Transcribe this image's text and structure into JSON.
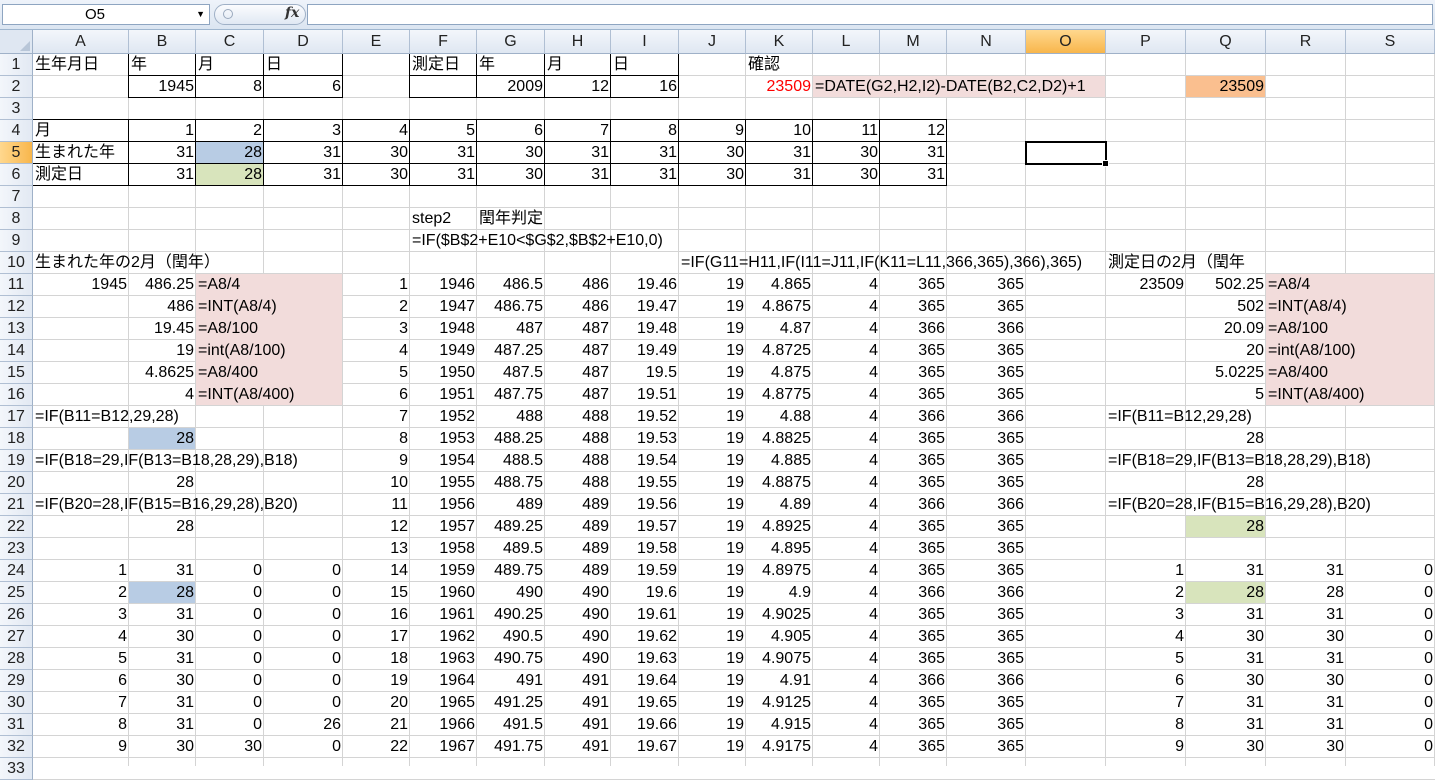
{
  "namebox": {
    "value": "O5",
    "dropdown_icon": "chevron-down-icon"
  },
  "formula_bar": {
    "fx_label": "fx",
    "value": ""
  },
  "columns": [
    "A",
    "B",
    "C",
    "D",
    "E",
    "F",
    "G",
    "H",
    "I",
    "J",
    "K",
    "L",
    "M",
    "N",
    "O",
    "P",
    "Q",
    "R",
    "S"
  ],
  "selected_column": "O",
  "selected_row": 5,
  "rows": [
    "1",
    "2",
    "3",
    "4",
    "5",
    "6",
    "7",
    "8",
    "9",
    "10",
    "11",
    "12",
    "13",
    "14",
    "15",
    "16",
    "17",
    "18",
    "19",
    "20",
    "21",
    "22",
    "23",
    "24",
    "25",
    "26",
    "27",
    "28",
    "29",
    "30",
    "31",
    "32",
    "33"
  ],
  "colors": {
    "pink": "#f2dcdb",
    "blue": "#b8cce4",
    "green": "#d8e4bc",
    "orange": "#fabf8f",
    "red_text": "#ff0000"
  },
  "cells": [
    {
      "c": "A",
      "r": 1,
      "v": "生年月日",
      "t": "txt"
    },
    {
      "c": "B",
      "r": 1,
      "v": "年",
      "t": "txt"
    },
    {
      "c": "C",
      "r": 1,
      "v": "月",
      "t": "txt"
    },
    {
      "c": "D",
      "r": 1,
      "v": "日",
      "t": "txt"
    },
    {
      "c": "F",
      "r": 1,
      "v": "測定日",
      "t": "txt"
    },
    {
      "c": "G",
      "r": 1,
      "v": "年",
      "t": "txt"
    },
    {
      "c": "H",
      "r": 1,
      "v": "月",
      "t": "txt"
    },
    {
      "c": "I",
      "r": 1,
      "v": "日",
      "t": "txt"
    },
    {
      "c": "K",
      "r": 1,
      "v": "確認",
      "t": "txt"
    },
    {
      "c": "B",
      "r": 2,
      "v": "1945",
      "t": "num"
    },
    {
      "c": "C",
      "r": 2,
      "v": "8",
      "t": "num"
    },
    {
      "c": "D",
      "r": 2,
      "v": "6",
      "t": "num"
    },
    {
      "c": "G",
      "r": 2,
      "v": "2009",
      "t": "num"
    },
    {
      "c": "H",
      "r": 2,
      "v": "12",
      "t": "num"
    },
    {
      "c": "I",
      "r": 2,
      "v": "16",
      "t": "num"
    },
    {
      "c": "K",
      "r": 2,
      "v": "23509",
      "t": "num",
      "red": true
    },
    {
      "c": "L",
      "r": 2,
      "v": "=DATE(G2,H2,I2)-DATE(B2,C2,D2)+1",
      "t": "txt"
    },
    {
      "c": "Q",
      "r": 2,
      "v": "23509",
      "t": "num"
    },
    {
      "c": "A",
      "r": 4,
      "v": "月",
      "t": "txt"
    },
    {
      "c": "B",
      "r": 4,
      "v": "1",
      "t": "num"
    },
    {
      "c": "C",
      "r": 4,
      "v": "2",
      "t": "num"
    },
    {
      "c": "D",
      "r": 4,
      "v": "3",
      "t": "num"
    },
    {
      "c": "E",
      "r": 4,
      "v": "4",
      "t": "num"
    },
    {
      "c": "F",
      "r": 4,
      "v": "5",
      "t": "num"
    },
    {
      "c": "G",
      "r": 4,
      "v": "6",
      "t": "num"
    },
    {
      "c": "H",
      "r": 4,
      "v": "7",
      "t": "num"
    },
    {
      "c": "I",
      "r": 4,
      "v": "8",
      "t": "num"
    },
    {
      "c": "J",
      "r": 4,
      "v": "9",
      "t": "num"
    },
    {
      "c": "K",
      "r": 4,
      "v": "10",
      "t": "num"
    },
    {
      "c": "L",
      "r": 4,
      "v": "11",
      "t": "num"
    },
    {
      "c": "M",
      "r": 4,
      "v": "12",
      "t": "num"
    },
    {
      "c": "A",
      "r": 5,
      "v": "生まれた年",
      "t": "txt"
    },
    {
      "c": "B",
      "r": 5,
      "v": "31",
      "t": "num"
    },
    {
      "c": "C",
      "r": 5,
      "v": "28",
      "t": "num"
    },
    {
      "c": "D",
      "r": 5,
      "v": "31",
      "t": "num"
    },
    {
      "c": "E",
      "r": 5,
      "v": "30",
      "t": "num"
    },
    {
      "c": "F",
      "r": 5,
      "v": "31",
      "t": "num"
    },
    {
      "c": "G",
      "r": 5,
      "v": "30",
      "t": "num"
    },
    {
      "c": "H",
      "r": 5,
      "v": "31",
      "t": "num"
    },
    {
      "c": "I",
      "r": 5,
      "v": "31",
      "t": "num"
    },
    {
      "c": "J",
      "r": 5,
      "v": "30",
      "t": "num"
    },
    {
      "c": "K",
      "r": 5,
      "v": "31",
      "t": "num"
    },
    {
      "c": "L",
      "r": 5,
      "v": "30",
      "t": "num"
    },
    {
      "c": "M",
      "r": 5,
      "v": "31",
      "t": "num"
    },
    {
      "c": "A",
      "r": 6,
      "v": "測定日",
      "t": "txt"
    },
    {
      "c": "B",
      "r": 6,
      "v": "31",
      "t": "num"
    },
    {
      "c": "C",
      "r": 6,
      "v": "28",
      "t": "num"
    },
    {
      "c": "D",
      "r": 6,
      "v": "31",
      "t": "num"
    },
    {
      "c": "E",
      "r": 6,
      "v": "30",
      "t": "num"
    },
    {
      "c": "F",
      "r": 6,
      "v": "31",
      "t": "num"
    },
    {
      "c": "G",
      "r": 6,
      "v": "30",
      "t": "num"
    },
    {
      "c": "H",
      "r": 6,
      "v": "31",
      "t": "num"
    },
    {
      "c": "I",
      "r": 6,
      "v": "31",
      "t": "num"
    },
    {
      "c": "J",
      "r": 6,
      "v": "30",
      "t": "num"
    },
    {
      "c": "K",
      "r": 6,
      "v": "31",
      "t": "num"
    },
    {
      "c": "L",
      "r": 6,
      "v": "30",
      "t": "num"
    },
    {
      "c": "M",
      "r": 6,
      "v": "31",
      "t": "num"
    },
    {
      "c": "F",
      "r": 8,
      "v": "step2",
      "t": "txt"
    },
    {
      "c": "G",
      "r": 8,
      "v": "閏年判定",
      "t": "txt"
    },
    {
      "c": "F",
      "r": 9,
      "v": "=IF($B$2+E10<$G$2,$B$2+E10,0)",
      "t": "txt"
    },
    {
      "c": "A",
      "r": 10,
      "v": "生まれた年の2月（閏年）",
      "t": "txt"
    },
    {
      "c": "J",
      "r": 10,
      "v": "=IF(G11=H11,IF(I11=J11,IF(K11=L11,366,365),366),365)",
      "t": "txt"
    },
    {
      "c": "P",
      "r": 10,
      "v": "測定日の2月（閏年",
      "t": "txt"
    },
    {
      "c": "A",
      "r": 11,
      "v": "1945",
      "t": "num"
    },
    {
      "c": "B",
      "r": 11,
      "v": "486.25",
      "t": "num"
    },
    {
      "c": "C",
      "r": 11,
      "v": "=A8/4",
      "t": "txt"
    },
    {
      "c": "B",
      "r": 12,
      "v": "486",
      "t": "num"
    },
    {
      "c": "C",
      "r": 12,
      "v": "=INT(A8/4)",
      "t": "txt"
    },
    {
      "c": "B",
      "r": 13,
      "v": "19.45",
      "t": "num"
    },
    {
      "c": "C",
      "r": 13,
      "v": "=A8/100",
      "t": "txt"
    },
    {
      "c": "B",
      "r": 14,
      "v": "19",
      "t": "num"
    },
    {
      "c": "C",
      "r": 14,
      "v": "=int(A8/100)",
      "t": "txt"
    },
    {
      "c": "B",
      "r": 15,
      "v": "4.8625",
      "t": "num"
    },
    {
      "c": "C",
      "r": 15,
      "v": "=A8/400",
      "t": "txt"
    },
    {
      "c": "B",
      "r": 16,
      "v": "4",
      "t": "num"
    },
    {
      "c": "C",
      "r": 16,
      "v": "=INT(A8/400)",
      "t": "txt"
    },
    {
      "c": "A",
      "r": 17,
      "v": "=IF(B11=B12,29,28)",
      "t": "txt"
    },
    {
      "c": "B",
      "r": 18,
      "v": "28",
      "t": "num"
    },
    {
      "c": "A",
      "r": 19,
      "v": "=IF(B18=29,IF(B13=B18,28,29),B18)",
      "t": "txt"
    },
    {
      "c": "B",
      "r": 20,
      "v": "28",
      "t": "num"
    },
    {
      "c": "A",
      "r": 21,
      "v": "=IF(B20=28,IF(B15=B16,29,28),B20)",
      "t": "txt"
    },
    {
      "c": "B",
      "r": 22,
      "v": "28",
      "t": "num"
    },
    {
      "c": "Q",
      "r": 11,
      "v": "502.25",
      "t": "num"
    },
    {
      "c": "P",
      "r": 11,
      "v": "23509",
      "t": "num"
    },
    {
      "c": "R",
      "r": 11,
      "v": "=A8/4",
      "t": "txt"
    },
    {
      "c": "Q",
      "r": 12,
      "v": "502",
      "t": "num"
    },
    {
      "c": "R",
      "r": 12,
      "v": "=INT(A8/4)",
      "t": "txt"
    },
    {
      "c": "Q",
      "r": 13,
      "v": "20.09",
      "t": "num"
    },
    {
      "c": "R",
      "r": 13,
      "v": "=A8/100",
      "t": "txt"
    },
    {
      "c": "Q",
      "r": 14,
      "v": "20",
      "t": "num"
    },
    {
      "c": "R",
      "r": 14,
      "v": "=int(A8/100)",
      "t": "txt"
    },
    {
      "c": "Q",
      "r": 15,
      "v": "5.0225",
      "t": "num"
    },
    {
      "c": "R",
      "r": 15,
      "v": "=A8/400",
      "t": "txt"
    },
    {
      "c": "Q",
      "r": 16,
      "v": "5",
      "t": "num"
    },
    {
      "c": "R",
      "r": 16,
      "v": "=INT(A8/400)",
      "t": "txt"
    },
    {
      "c": "P",
      "r": 17,
      "v": "=IF(B11=B12,29,28)",
      "t": "txt"
    },
    {
      "c": "Q",
      "r": 18,
      "v": "28",
      "t": "num"
    },
    {
      "c": "P",
      "r": 19,
      "v": "=IF(B18=29,IF(B13=B18,28,29),B18)",
      "t": "txt"
    },
    {
      "c": "Q",
      "r": 20,
      "v": "28",
      "t": "num"
    },
    {
      "c": "P",
      "r": 21,
      "v": "=IF(B20=28,IF(B15=B16,29,28),B20)",
      "t": "txt"
    },
    {
      "c": "Q",
      "r": 22,
      "v": "28",
      "t": "num"
    }
  ],
  "leap_table": [
    {
      "r": 11,
      "E": "1",
      "F": "1946",
      "G": "486.5",
      "H": "486",
      "I": "19.46",
      "J": "19",
      "K": "4.865",
      "L": "4",
      "M": "365",
      "N": "365"
    },
    {
      "r": 12,
      "E": "2",
      "F": "1947",
      "G": "486.75",
      "H": "486",
      "I": "19.47",
      "J": "19",
      "K": "4.8675",
      "L": "4",
      "M": "365",
      "N": "365"
    },
    {
      "r": 13,
      "E": "3",
      "F": "1948",
      "G": "487",
      "H": "487",
      "I": "19.48",
      "J": "19",
      "K": "4.87",
      "L": "4",
      "M": "366",
      "N": "366"
    },
    {
      "r": 14,
      "E": "4",
      "F": "1949",
      "G": "487.25",
      "H": "487",
      "I": "19.49",
      "J": "19",
      "K": "4.8725",
      "L": "4",
      "M": "365",
      "N": "365"
    },
    {
      "r": 15,
      "E": "5",
      "F": "1950",
      "G": "487.5",
      "H": "487",
      "I": "19.5",
      "J": "19",
      "K": "4.875",
      "L": "4",
      "M": "365",
      "N": "365"
    },
    {
      "r": 16,
      "E": "6",
      "F": "1951",
      "G": "487.75",
      "H": "487",
      "I": "19.51",
      "J": "19",
      "K": "4.8775",
      "L": "4",
      "M": "365",
      "N": "365"
    },
    {
      "r": 17,
      "E": "7",
      "F": "1952",
      "G": "488",
      "H": "488",
      "I": "19.52",
      "J": "19",
      "K": "4.88",
      "L": "4",
      "M": "366",
      "N": "366"
    },
    {
      "r": 18,
      "E": "8",
      "F": "1953",
      "G": "488.25",
      "H": "488",
      "I": "19.53",
      "J": "19",
      "K": "4.8825",
      "L": "4",
      "M": "365",
      "N": "365"
    },
    {
      "r": 19,
      "E": "9",
      "F": "1954",
      "G": "488.5",
      "H": "488",
      "I": "19.54",
      "J": "19",
      "K": "4.885",
      "L": "4",
      "M": "365",
      "N": "365"
    },
    {
      "r": 20,
      "E": "10",
      "F": "1955",
      "G": "488.75",
      "H": "488",
      "I": "19.55",
      "J": "19",
      "K": "4.8875",
      "L": "4",
      "M": "365",
      "N": "365"
    },
    {
      "r": 21,
      "E": "11",
      "F": "1956",
      "G": "489",
      "H": "489",
      "I": "19.56",
      "J": "19",
      "K": "4.89",
      "L": "4",
      "M": "366",
      "N": "366"
    },
    {
      "r": 22,
      "E": "12",
      "F": "1957",
      "G": "489.25",
      "H": "489",
      "I": "19.57",
      "J": "19",
      "K": "4.8925",
      "L": "4",
      "M": "365",
      "N": "365"
    },
    {
      "r": 23,
      "E": "13",
      "F": "1958",
      "G": "489.5",
      "H": "489",
      "I": "19.58",
      "J": "19",
      "K": "4.895",
      "L": "4",
      "M": "365",
      "N": "365"
    },
    {
      "r": 24,
      "E": "14",
      "F": "1959",
      "G": "489.75",
      "H": "489",
      "I": "19.59",
      "J": "19",
      "K": "4.8975",
      "L": "4",
      "M": "365",
      "N": "365"
    },
    {
      "r": 25,
      "E": "15",
      "F": "1960",
      "G": "490",
      "H": "490",
      "I": "19.6",
      "J": "19",
      "K": "4.9",
      "L": "4",
      "M": "366",
      "N": "366"
    },
    {
      "r": 26,
      "E": "16",
      "F": "1961",
      "G": "490.25",
      "H": "490",
      "I": "19.61",
      "J": "19",
      "K": "4.9025",
      "L": "4",
      "M": "365",
      "N": "365"
    },
    {
      "r": 27,
      "E": "17",
      "F": "1962",
      "G": "490.5",
      "H": "490",
      "I": "19.62",
      "J": "19",
      "K": "4.905",
      "L": "4",
      "M": "365",
      "N": "365"
    },
    {
      "r": 28,
      "E": "18",
      "F": "1963",
      "G": "490.75",
      "H": "490",
      "I": "19.63",
      "J": "19",
      "K": "4.9075",
      "L": "4",
      "M": "365",
      "N": "365"
    },
    {
      "r": 29,
      "E": "19",
      "F": "1964",
      "G": "491",
      "H": "491",
      "I": "19.64",
      "J": "19",
      "K": "4.91",
      "L": "4",
      "M": "366",
      "N": "366"
    },
    {
      "r": 30,
      "E": "20",
      "F": "1965",
      "G": "491.25",
      "H": "491",
      "I": "19.65",
      "J": "19",
      "K": "4.9125",
      "L": "4",
      "M": "365",
      "N": "365"
    },
    {
      "r": 31,
      "E": "21",
      "F": "1966",
      "G": "491.5",
      "H": "491",
      "I": "19.66",
      "J": "19",
      "K": "4.915",
      "L": "4",
      "M": "365",
      "N": "365"
    },
    {
      "r": 32,
      "E": "22",
      "F": "1967",
      "G": "491.75",
      "H": "491",
      "I": "19.67",
      "J": "19",
      "K": "4.9175",
      "L": "4",
      "M": "365",
      "N": "365"
    }
  ],
  "month_table": [
    {
      "r": 24,
      "A": "1",
      "B": "31",
      "C": "0",
      "D": "0",
      "P": "1",
      "Q": "31",
      "R": "31",
      "S": "0"
    },
    {
      "r": 25,
      "A": "2",
      "B": "28",
      "C": "0",
      "D": "0",
      "P": "2",
      "Q": "28",
      "R": "28",
      "S": "0"
    },
    {
      "r": 26,
      "A": "3",
      "B": "31",
      "C": "0",
      "D": "0",
      "P": "3",
      "Q": "31",
      "R": "31",
      "S": "0"
    },
    {
      "r": 27,
      "A": "4",
      "B": "30",
      "C": "0",
      "D": "0",
      "P": "4",
      "Q": "30",
      "R": "30",
      "S": "0"
    },
    {
      "r": 28,
      "A": "5",
      "B": "31",
      "C": "0",
      "D": "0",
      "P": "5",
      "Q": "31",
      "R": "31",
      "S": "0"
    },
    {
      "r": 29,
      "A": "6",
      "B": "30",
      "C": "0",
      "D": "0",
      "P": "6",
      "Q": "30",
      "R": "30",
      "S": "0"
    },
    {
      "r": 30,
      "A": "7",
      "B": "31",
      "C": "0",
      "D": "0",
      "P": "7",
      "Q": "31",
      "R": "31",
      "S": "0"
    },
    {
      "r": 31,
      "A": "8",
      "B": "31",
      "C": "0",
      "D": "26",
      "P": "8",
      "Q": "31",
      "R": "31",
      "S": "0"
    },
    {
      "r": 32,
      "A": "9",
      "B": "30",
      "C": "30",
      "D": "0",
      "P": "9",
      "Q": "30",
      "R": "30",
      "S": "0"
    }
  ]
}
